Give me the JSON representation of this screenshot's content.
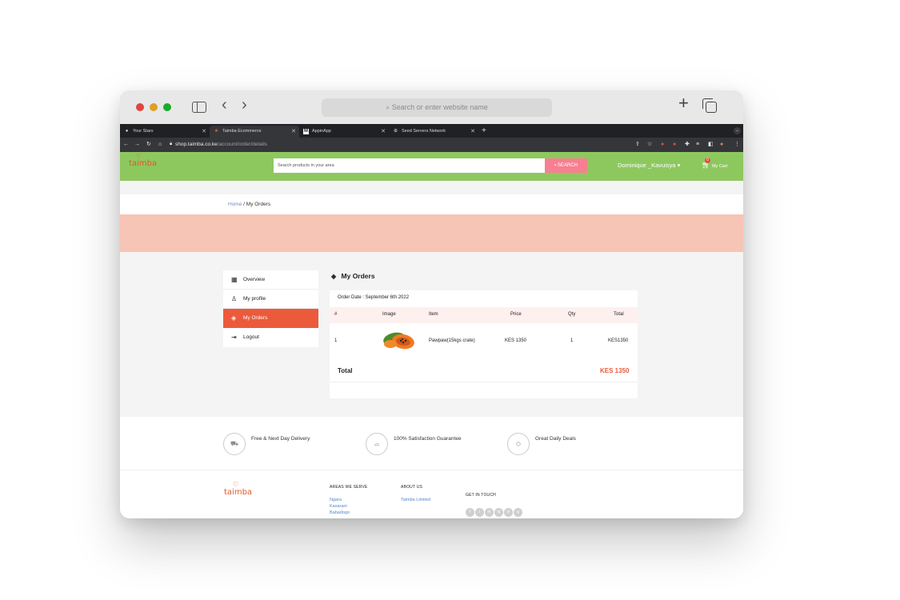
{
  "safari": {
    "address_placeholder": "Search or enter website name",
    "icons": [
      "sidebar-icon",
      "back-icon",
      "forward-icon",
      "search-icon",
      "new-tab-icon",
      "tab-overview-icon"
    ]
  },
  "chrome": {
    "tabs": [
      {
        "label": "Your Stars",
        "active": false
      },
      {
        "label": "Taimba Ecommerce",
        "active": true
      },
      {
        "label": "AppinApp",
        "active": false
      },
      {
        "label": "Seed Servers Network",
        "active": false
      }
    ],
    "url_host": "shop.taimba.co.ke",
    "url_path": "/account/order/details"
  },
  "site": {
    "logo": "taimba",
    "search_placeholder": "Search products in your area",
    "search_button": "SEARCH",
    "user_name": "Dominique _Kavuisya",
    "cart_label": "My Cart",
    "cart_count": "0",
    "breadcrumb": {
      "home": "Home",
      "separator": "/",
      "current": "My Orders"
    },
    "colors": {
      "header": "#8dc85e",
      "accent": "#ec5a3c",
      "banner": "#f7c5b6",
      "search_button": "#f77f90"
    }
  },
  "sidebar": {
    "items": [
      {
        "label": "Overview",
        "icon": "grid-icon"
      },
      {
        "label": "My profile",
        "icon": "user-icon"
      },
      {
        "label": "My Orders",
        "icon": "box-icon",
        "active": true
      },
      {
        "label": "Logout",
        "icon": "logout-icon"
      }
    ]
  },
  "orders": {
    "title": "My Orders",
    "order_date": "Order Date : September 6th 2022",
    "columns": [
      "#",
      "Image",
      "Item",
      "Price",
      "Qty",
      "Total"
    ],
    "rows": [
      {
        "index": "1",
        "image": "papaya-image",
        "item": "Pawpaw(15kgs crate)",
        "price": "KES 1350",
        "qty": "1",
        "total": "KES1350"
      }
    ],
    "total_label": "Total",
    "total_value": "KES 1350"
  },
  "features": [
    {
      "label": "Free & Next Day Delivery",
      "icon": "delivery-icon"
    },
    {
      "label": "100% Satisfaction Guarantee",
      "icon": "basket-icon"
    },
    {
      "label": "Great Daily Deals",
      "icon": "tag-icon"
    }
  ],
  "footer": {
    "logo": "taimba",
    "areas_heading": "AREAS WE SERVE",
    "areas": [
      "Ngara",
      "Kasarani",
      "Babadogo"
    ],
    "about_heading": "ABOUT US",
    "about_links": [
      "Taimba Limited"
    ],
    "contact_heading": "GET IN TOUCH",
    "social": [
      "f",
      "t",
      "in",
      "ig",
      "yt",
      "g"
    ]
  }
}
